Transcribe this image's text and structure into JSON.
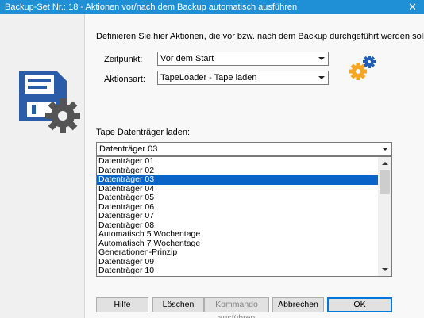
{
  "window": {
    "title": "Backup-Set Nr.: 18 - Aktionen vor/nach dem Backup automatisch ausführen",
    "close_glyph": "✕"
  },
  "dialog": {
    "description": "Definieren Sie hier Aktionen, die vor bzw. nach dem Backup durchgeführt werden sollen.",
    "zeitpunkt": {
      "label": "Zeitpunkt:",
      "value": "Vor dem Start"
    },
    "aktionsart": {
      "label": "Aktionsart:",
      "value": "TapeLoader - Tape laden"
    },
    "tape_label": "Tape Datenträger laden:",
    "tape_combo": {
      "value": "Datenträger 03"
    },
    "tape_list": {
      "selected_index": 2,
      "items": [
        "Datenträger 01",
        "Datenträger 02",
        "Datenträger 03",
        "Datenträger 04",
        "Datenträger 05",
        "Datenträger 06",
        "Datenträger 07",
        "Datenträger 08",
        "Automatisch 5 Wochentage",
        "Automatisch 7 Wochentage",
        "Generationen-Prinzip",
        "Datenträger 09",
        "Datenträger 10"
      ]
    }
  },
  "buttons": {
    "hilfe": "Hilfe",
    "loeschen": "Löschen",
    "kommando": "Kommando ausführen",
    "abbrechen": "Abbrechen",
    "ok": "OK"
  },
  "icons": {
    "logo": "floppy-disk-gear-icon",
    "action": "gears-icon"
  },
  "colors": {
    "titlebar": "#1f8fd6",
    "selection": "#0a64c8",
    "logo_blue": "#2a5ca8",
    "gear_gray": "#545454",
    "gear_orange": "#f5a623",
    "gear_blue": "#1e5fb4"
  }
}
